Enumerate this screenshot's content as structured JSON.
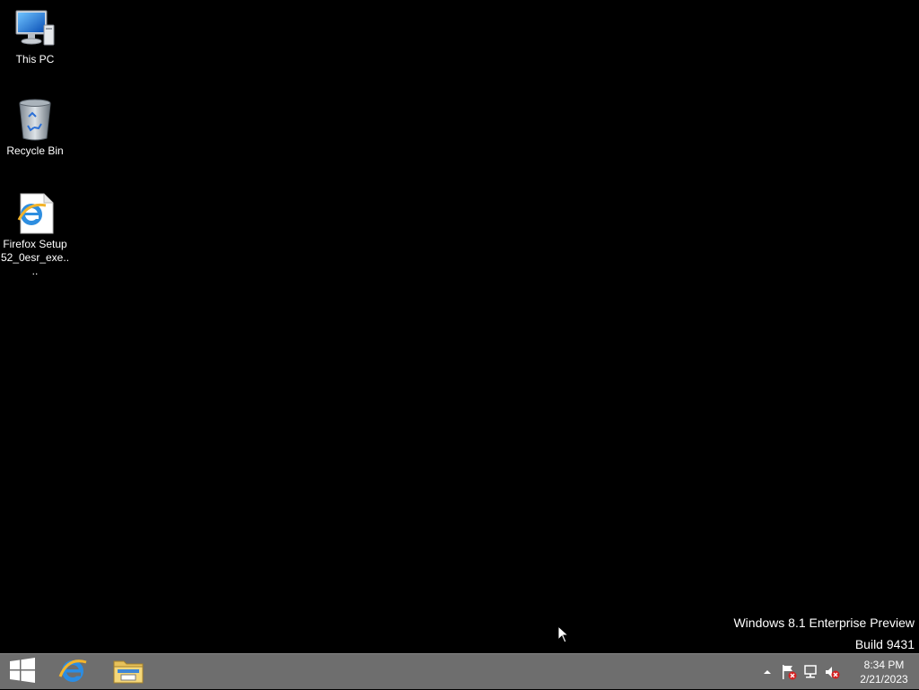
{
  "desktop": {
    "icons": [
      {
        "label": "This PC",
        "icon": "computer-icon"
      },
      {
        "label": "Recycle Bin",
        "icon": "recycle-bin-icon"
      },
      {
        "label": "Firefox Setup 52_0esr_exe....",
        "icon": "internet-explorer-file-icon"
      }
    ],
    "watermark": {
      "line1": "Windows 8.1 Enterprise Preview",
      "line2": "Build 9431"
    }
  },
  "taskbar": {
    "pinned": [
      {
        "name": "start",
        "icon": "windows-logo-icon"
      },
      {
        "name": "internet-explorer",
        "icon": "internet-explorer-icon"
      },
      {
        "name": "file-explorer",
        "icon": "folder-icon"
      }
    ],
    "tray": {
      "icons": [
        "show-hidden-icons-arrow",
        "action-center-flag-icon",
        "network-icon",
        "volume-muted-icon"
      ],
      "time": "8:34 PM",
      "date": "2/21/2023"
    }
  },
  "colors": {
    "desktop_bg": "#000000",
    "taskbar_bg": "#6e6e6e",
    "text": "#ffffff"
  }
}
